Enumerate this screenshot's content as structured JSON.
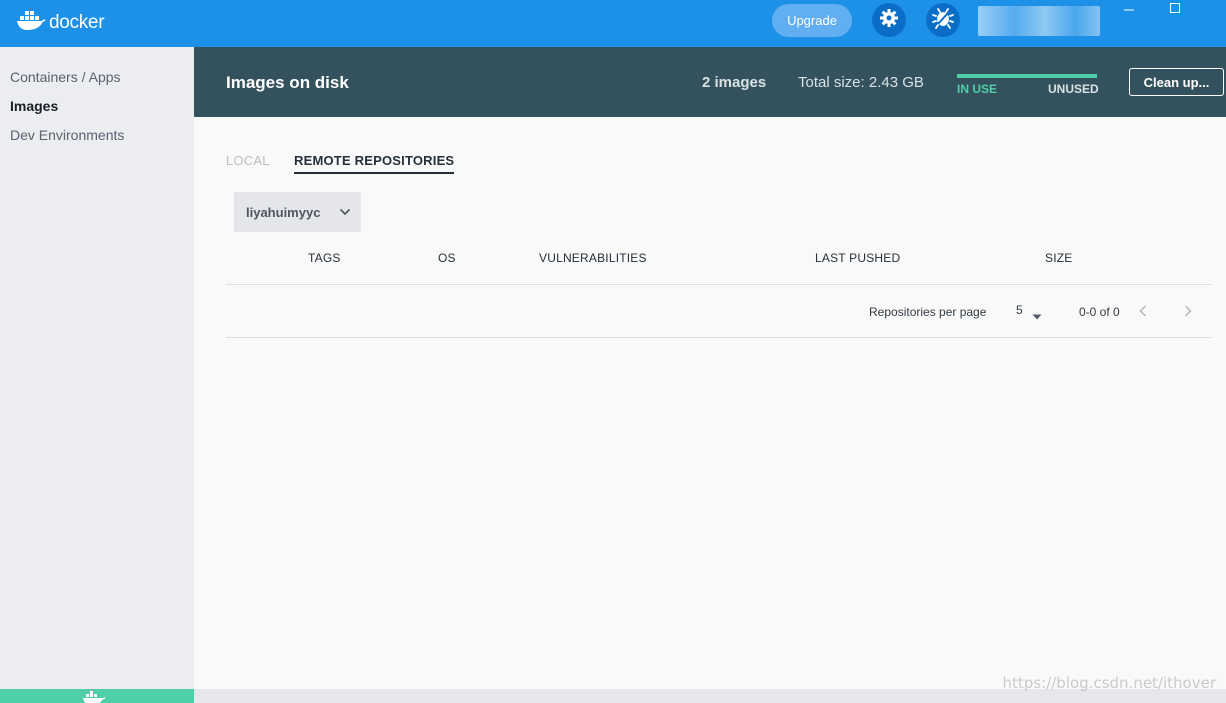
{
  "app": {
    "logo_text": "docker",
    "upgrade_label": "Upgrade"
  },
  "sidebar": {
    "items": [
      {
        "label": "Containers / Apps"
      },
      {
        "label": "Images"
      },
      {
        "label": "Dev Environments"
      }
    ]
  },
  "header": {
    "title": "Images on disk",
    "count": "2 images",
    "total_size": "Total size: 2.43 GB",
    "in_use_label": "IN USE",
    "unused_label": "UNUSED",
    "cleanup_label": "Clean up..."
  },
  "tabs": {
    "local": "LOCAL",
    "remote": "REMOTE REPOSITORIES"
  },
  "repo_select": {
    "value": "liyahuimyyc"
  },
  "table": {
    "columns": [
      "TAGS",
      "OS",
      "VULNERABILITIES",
      "LAST PUSHED",
      "SIZE"
    ]
  },
  "pagination": {
    "per_page_label": "Repositories per page",
    "per_page_value": "5",
    "range": "0-0 of 0"
  },
  "watermark": "https://blog.csdn.net/ithover",
  "colors": {
    "topbar": "#1d91e8",
    "header": "#33525d",
    "accent_green": "#4fcfa8"
  }
}
